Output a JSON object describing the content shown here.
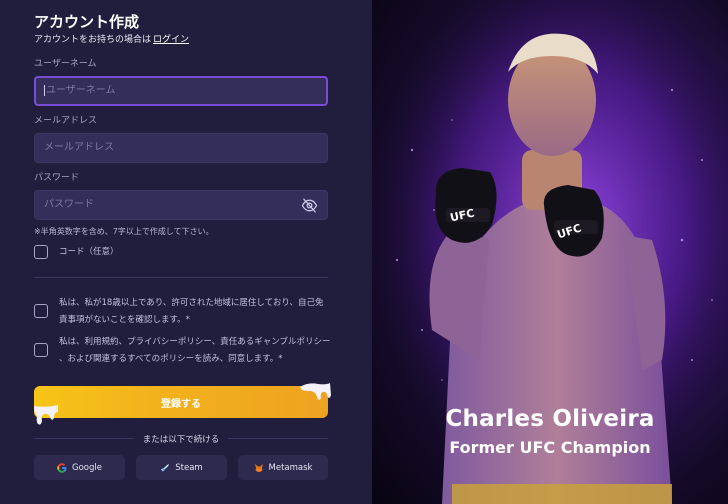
{
  "form": {
    "title": "アカウント作成",
    "subtitle": "アカウントをお持ちの場合は",
    "login_link": "ログイン",
    "username": {
      "label": "ユーザーネーム",
      "placeholder": "ユーザーネーム",
      "value": ""
    },
    "email": {
      "label": "メールアドレス",
      "placeholder": "メールアドレス",
      "value": ""
    },
    "password": {
      "label": "パスワード",
      "placeholder": "パスワード",
      "value": ""
    },
    "password_hint": "※半角英数字を含め、7字以上で作成して下さい。",
    "code_label": "コード（任意）",
    "terms_age_line1": "私は、私が18歳以上であり、許可された地域に居住しており、自己免",
    "terms_age_line2": "責事項がないことを確認します。*",
    "terms_policy_line1": "私は、利用規約、プライバシーポリシー、責任あるギャンブルポリシー",
    "terms_policy_line2": "、および関連するすべてのポリシーを読み、同意します。*",
    "register_button": "登録する",
    "continue_with": "または以下で続ける",
    "social": {
      "google": "Google",
      "steam": "Steam",
      "metamask": "Metamask"
    }
  },
  "promo": {
    "name": "Charles Oliveira",
    "role": "Former UFC Champion",
    "glove_text": "UFC"
  },
  "colors": {
    "panel_bg": "#201e3c",
    "input_bg": "#332f5a",
    "focus_border": "#7a4bd6",
    "button_yellow": "#f5bb1a",
    "promo_purple": "#6a2bb5"
  }
}
